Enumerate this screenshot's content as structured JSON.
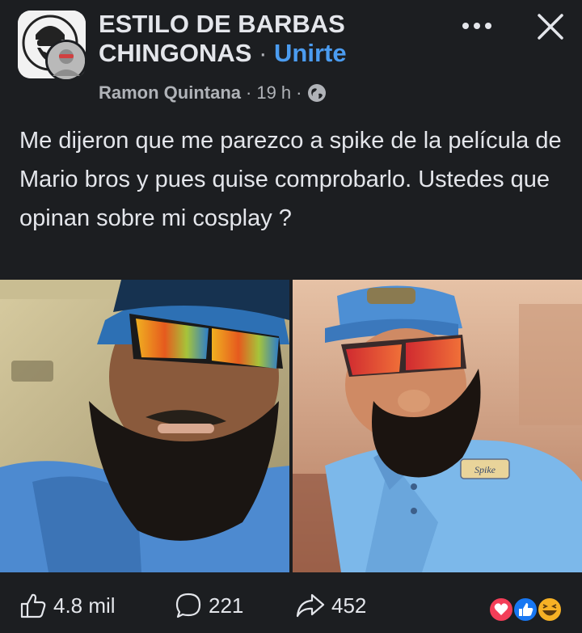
{
  "post": {
    "group_name": "ESTILO DE BARBAS CHINGONAS",
    "separator": "·",
    "join_label": "Unirte",
    "author": "Ramon Quintana",
    "meta_sep": "·",
    "time": "19 h",
    "meta_sep2": "·",
    "privacy_icon": "globe-icon",
    "text": "Me dijeron que me parezco a spike de la película de Mario bros y pues quise comprobarlo.   Ustedes que opinan sobre mi cosplay ?"
  },
  "photos": {
    "right_badge": "Spike"
  },
  "actions": {
    "likes": "4.8 mil",
    "comments": "221",
    "shares": "452",
    "reactions": [
      "love-reaction-icon",
      "like-reaction-icon",
      "haha-reaction-icon"
    ]
  },
  "colors": {
    "background": "#1c1e21",
    "link": "#4b9cf0",
    "text": "#e4e6eb",
    "muted": "#b0b3b8"
  }
}
